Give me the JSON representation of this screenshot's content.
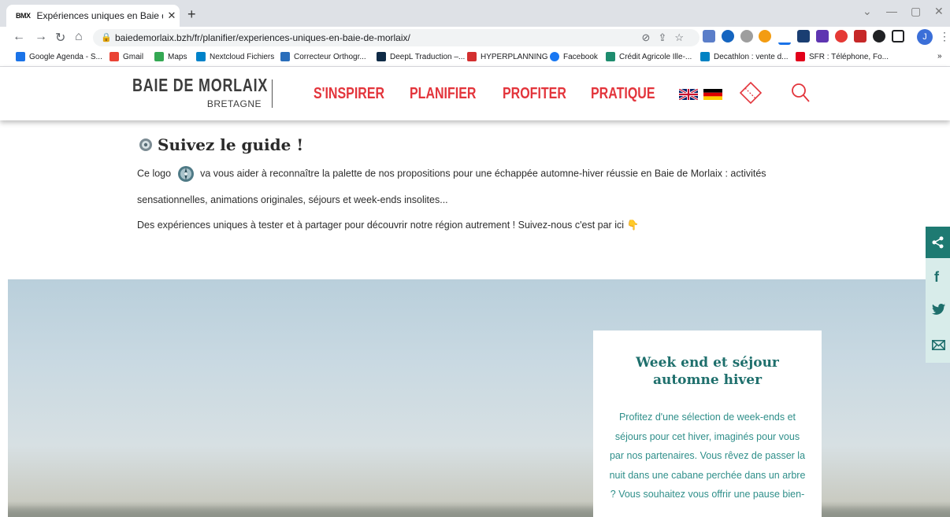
{
  "browser": {
    "tab_title": "Expériences uniques en Baie de M",
    "tab_favicon": "BMX",
    "url": "baiedemorlaix.bzh/fr/planifier/experiences-uniques-en-baie-de-morlaix/",
    "profile_initial": "J",
    "bookmarks": [
      {
        "label": "Google Agenda - S...",
        "color": "#1a73e8"
      },
      {
        "label": "Gmail",
        "color": "#ea4335"
      },
      {
        "label": "Maps",
        "color": "#34a853"
      },
      {
        "label": "Nextcloud Fichiers",
        "color": "#0082c9"
      },
      {
        "label": "Correcteur Orthogr...",
        "color": "#2a6ebb"
      },
      {
        "label": "DeepL Traduction –...",
        "color": "#0f2b46"
      },
      {
        "label": "HYPERPLANNING",
        "color": "#d32f2f"
      },
      {
        "label": "Facebook",
        "color": "#1877f2"
      },
      {
        "label": "Crédit Agricole Ille-...",
        "color": "#1e8c6e"
      },
      {
        "label": "Decathlon : vente d...",
        "color": "#0082c3"
      },
      {
        "label": "SFR : Téléphone, Fo...",
        "color": "#e2001a"
      }
    ],
    "more_bookmarks": "»"
  },
  "site": {
    "logo_line1": "BAIE DE MORLAIX",
    "logo_line2": "BRETAGNE",
    "nav": [
      "S'INSPIRER",
      "PLANIFIER",
      "PROFITER",
      "PRATIQUE"
    ],
    "accent_color": "#e3353c"
  },
  "guide": {
    "title": "Suivez le guide !",
    "p1_before": "Ce logo",
    "p1_after": "va vous aider à reconnaître la palette de nos propositions pour une échappée automne-hiver réussie en Baie de Morlaix : activités",
    "p1_line2": "sensationnelles, animations originales, séjours et week-ends insolites...",
    "p2": "Des expériences uniques à tester et à partager pour découvrir notre région autrement ! Suivez-nous c'est par ici 👇"
  },
  "card": {
    "title_line1": "Week end et séjour",
    "title_line2": "automne hiver",
    "text": "Profitez d'une sélection de week-ends et séjours pour cet hiver, imaginés pour vous par nos partenaires. Vous rêvez de passer la nuit dans une cabane perchée dans un arbre ? Vous souhaitez vous offrir une pause bien-"
  },
  "share": {
    "icons": [
      "share-icon",
      "facebook-icon",
      "twitter-icon",
      "email-icon"
    ],
    "facebook_glyph": "f"
  }
}
